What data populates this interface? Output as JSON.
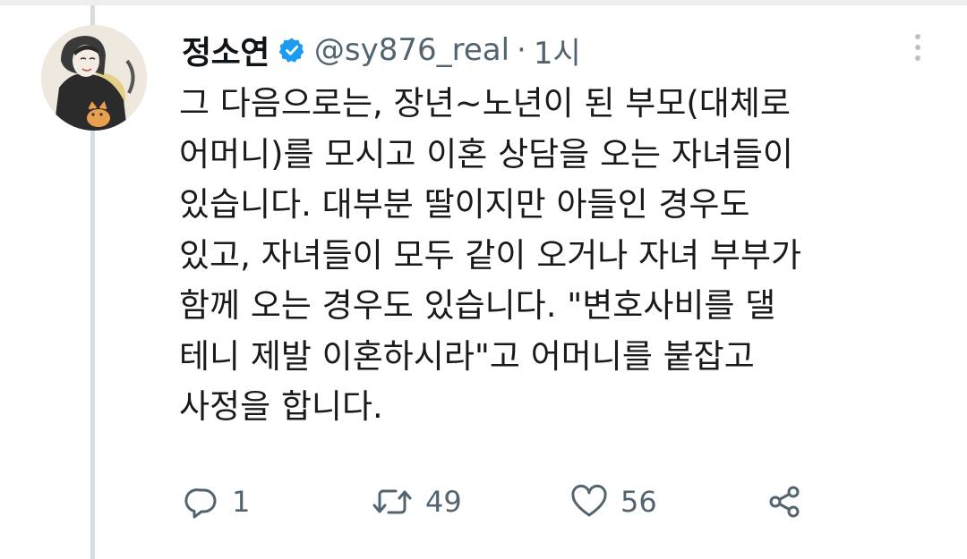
{
  "tweet": {
    "display_name": "정소연",
    "verified": true,
    "handle": "@sy876_real",
    "separator": "·",
    "time": "1시",
    "text_lines": [
      "그 다음으로는, 장년~노년이 된 부모(대체로",
      "어머니)를 모시고 이혼 상담을 오는 자녀들이",
      "있습니다. 대부분 딸이지만 아들인 경우도",
      "있고, 자녀들이 모두 같이 오거나 자녀 부부가",
      "함께 오는 경우도 있습니다. \"변호사비를 댈",
      "테니 제발 이혼하시라\"고 어머니를 붙잡고",
      "사정을 합니다."
    ]
  },
  "actions": {
    "reply_count": "1",
    "retweet_count": "49",
    "like_count": "56"
  },
  "icons": {
    "verified": "verified-badge-icon",
    "more": "more-vertical-icon",
    "reply": "reply-icon",
    "retweet": "retweet-icon",
    "like": "heart-icon",
    "share": "share-icon"
  },
  "colors": {
    "verified": "#1d9bf0",
    "secondary_text": "#536471",
    "thread_line": "#d6dbe0"
  }
}
